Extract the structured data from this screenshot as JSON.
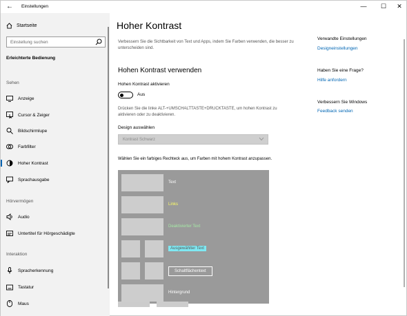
{
  "titlebar": {
    "title": "Einstellungen",
    "back_glyph": "←",
    "minimize_glyph": "—",
    "maximize_glyph": "☐",
    "close_glyph": "✕"
  },
  "sidebar": {
    "home_label": "Startseite",
    "search_placeholder": "Einstellung suchen",
    "category": "Erleichterte Bedienung",
    "sections": {
      "sehen": "Sehen",
      "hoervermoegen": "Hörvermögen",
      "interaktion": "Interaktion"
    },
    "items": [
      {
        "label": "Anzeige",
        "icon": "display-icon"
      },
      {
        "label": "Cursor & Zeiger",
        "icon": "cursor-icon"
      },
      {
        "label": "Bildschirmlupe",
        "icon": "magnifier-icon"
      },
      {
        "label": "Farbfilter",
        "icon": "color-filter-icon"
      },
      {
        "label": "Hoher Kontrast",
        "icon": "high-contrast-icon"
      },
      {
        "label": "Sprachausgabe",
        "icon": "narrator-icon"
      },
      {
        "label": "Audio",
        "icon": "speaker-icon"
      },
      {
        "label": "Untertitel für Hörgeschädigte",
        "icon": "captions-icon"
      },
      {
        "label": "Spracherkennung",
        "icon": "microphone-icon"
      },
      {
        "label": "Tastatur",
        "icon": "keyboard-icon"
      },
      {
        "label": "Maus",
        "icon": "mouse-icon"
      }
    ],
    "active_item": "Hoher Kontrast"
  },
  "main": {
    "title": "Hoher Kontrast",
    "description": "Verbessern Sie die Sichtbarkeit von Text und Apps, indem Sie Farben verwenden, die besser zu unterscheiden sind.",
    "section_title": "Hohen Kontrast verwenden",
    "toggle_label": "Hohen Kontrast aktivieren",
    "toggle_state": "Aus",
    "hint": "Drücken Sie die linke ALT-+UMSCHALTTASTE+DRUCKTASTE, um hohen Kontrast zu aktivieren oder zu deaktivieren.",
    "design_label": "Design auswählen",
    "design_value": "Kontrast Schwarz",
    "instruction": "Wählen Sie ein farbiges Rechteck aus, um Farben mit hohem Kontrast anzupassen.",
    "preview": {
      "text": "Text",
      "links": "Links",
      "disabled_text": "Deaktivierter Text",
      "selected_text": "Ausgewählter Text",
      "button_text": "Schaltflächentext",
      "background": "Hintergrund"
    }
  },
  "right": {
    "related_heading": "Verwandte Einstellungen",
    "related_link": "Designeinstellungen",
    "question_heading": "Haben Sie eine Frage?",
    "question_link": "Hilfe anfordern",
    "improve_heading": "Verbessern Sie Windows",
    "improve_link": "Feedback senden"
  },
  "colors": {
    "accent": "#0066b4",
    "sidebar_bg": "#f2f2f2",
    "preview_bg": "#9a9a9a",
    "links": "#ffff66",
    "disabled": "#a6e9a6",
    "selected_bg": "#7fe8f2"
  }
}
